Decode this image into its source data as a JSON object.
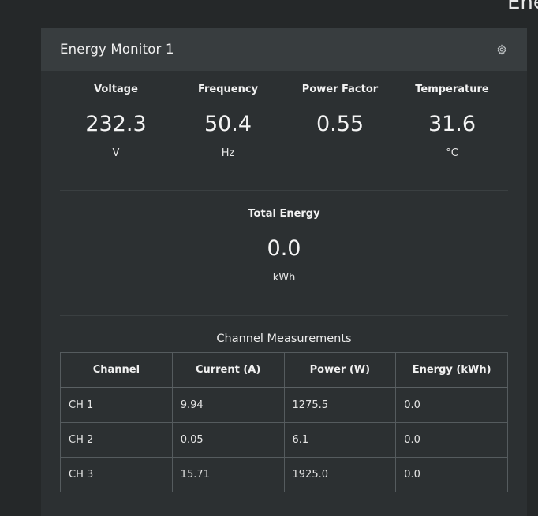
{
  "page": {
    "title_fragment": "Ene"
  },
  "card": {
    "title": "Energy Monitor 1",
    "settings_icon": "gear-icon"
  },
  "metrics": [
    {
      "label": "Voltage",
      "value": "232.3",
      "unit": "V"
    },
    {
      "label": "Frequency",
      "value": "50.4",
      "unit": "Hz"
    },
    {
      "label": "Power Factor",
      "value": "0.55",
      "unit": ""
    },
    {
      "label": "Temperature",
      "value": "31.6",
      "unit": "°C"
    }
  ],
  "total_energy": {
    "label": "Total Energy",
    "value": "0.0",
    "unit": "kWh"
  },
  "channels": {
    "caption": "Channel Measurements",
    "headers": [
      "Channel",
      "Current (A)",
      "Power (W)",
      "Energy (kWh)"
    ],
    "rows": [
      [
        "CH 1",
        "9.94",
        "1275.5",
        "0.0"
      ],
      [
        "CH 2",
        "0.05",
        "6.1",
        "0.0"
      ],
      [
        "CH 3",
        "15.71",
        "1925.0",
        "0.0"
      ]
    ]
  }
}
